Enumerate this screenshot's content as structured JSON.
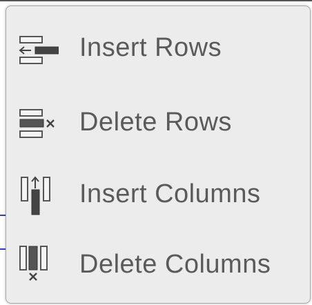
{
  "menu": {
    "items": [
      {
        "label": "Insert Rows",
        "icon": "insert-rows-icon"
      },
      {
        "label": "Delete Rows",
        "icon": "delete-rows-icon"
      },
      {
        "label": "Insert Columns",
        "icon": "insert-columns-icon"
      },
      {
        "label": "Delete Columns",
        "icon": "delete-columns-icon"
      }
    ]
  }
}
